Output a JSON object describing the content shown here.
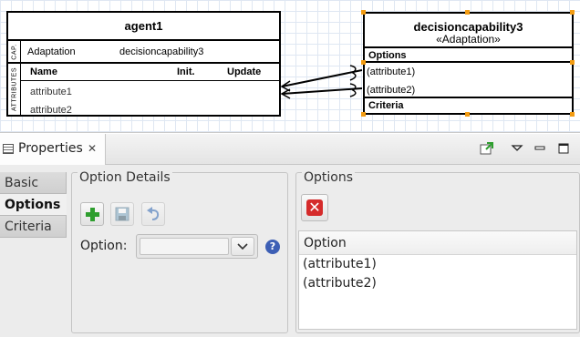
{
  "diagram": {
    "agent": {
      "name": "agent1",
      "cap_section_label": "CAP.",
      "capability_name": "Adaptation",
      "capability_target": "decisioncapability3",
      "attributes_section_label": "ATTRIBUTES",
      "columns": [
        "Name",
        "Init.",
        "Update"
      ],
      "attributes": [
        "attribute1",
        "attribute2"
      ]
    },
    "decision_capability": {
      "name": "decisioncapability3",
      "stereotype": "«Adaptation»",
      "options_label": "Options",
      "options": [
        "(attribute1)",
        "(attribute2)"
      ],
      "criteria_label": "Criteria"
    }
  },
  "properties_view": {
    "tab_title": "Properties",
    "close_glyph": "✕",
    "side_tabs": [
      "Basic",
      "Options",
      "Criteria"
    ],
    "active_tab": "Options",
    "option_details": {
      "title": "Option Details",
      "option_label": "Option:",
      "option_value": "",
      "help_glyph": "?"
    },
    "options_panel": {
      "title": "Options",
      "delete_glyph": "✕",
      "column_header": "Option",
      "rows": [
        "(attribute1)",
        "(attribute2)"
      ]
    }
  },
  "icons": {
    "add": "add-icon",
    "save": "save-icon",
    "undo": "undo-icon",
    "delete": "delete-icon",
    "help": "help-icon",
    "dropdown": "chevron-down-icon",
    "view_menu": "view-menu-icon",
    "minimize": "minimize-icon",
    "maximize": "maximize-icon",
    "pin": "pin-icon"
  },
  "colors": {
    "selection_handle": "#f39c12",
    "delete_red": "#d52b2b",
    "add_green": "#2e9e2e",
    "help_blue": "#3d5fb5"
  }
}
